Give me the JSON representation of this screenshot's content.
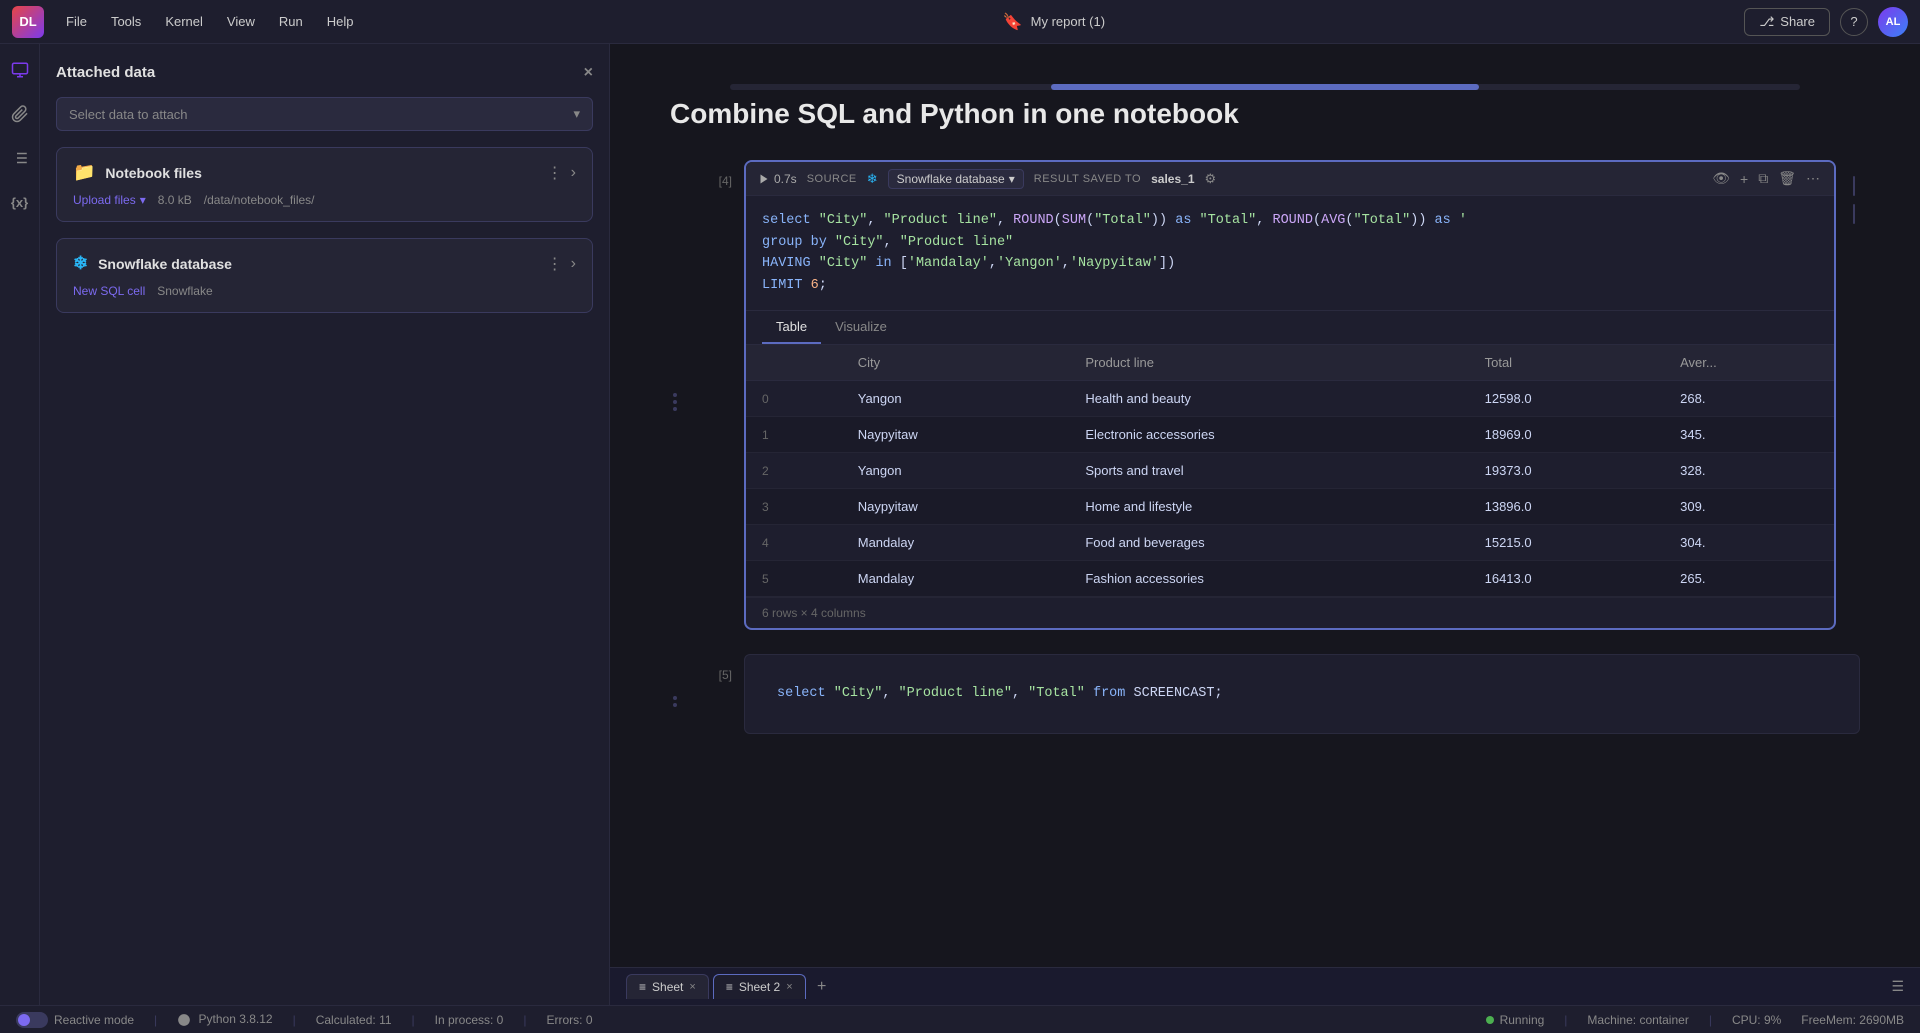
{
  "app": {
    "logo_text": "DL",
    "menu_items": [
      "File",
      "Tools",
      "Kernel",
      "View",
      "Run",
      "Help"
    ],
    "report_title": "My report (1)",
    "share_label": "Share",
    "help_label": "?",
    "avatar_text": "AL"
  },
  "left_panel": {
    "title": "Attached data",
    "close_label": "×",
    "select_placeholder": "Select data to attach",
    "cards": [
      {
        "id": "notebook_files",
        "title": "Notebook files",
        "upload_label": "Upload files",
        "size": "8.0 kB",
        "path": "/data/notebook_files/"
      },
      {
        "id": "snowflake_db",
        "title": "Snowflake database",
        "new_sql_label": "New SQL cell",
        "source": "Snowflake"
      }
    ]
  },
  "notebook": {
    "title": "Combine SQL and Python in one notebook",
    "cells": [
      {
        "number": "[4]",
        "run_time": "0.7s",
        "source": "Snowflake database",
        "result_saved_to": "sales_1",
        "code_lines": [
          "select \"City\", \"Product line\", ROUND(SUM(\"Total\")) as \"Total\", ROUND(AVG(\"Total\")) as '",
          "group by \"City\", \"Product line\"",
          "HAVING \"City\" in ['Mandalay','Yangon','Naypyitaw'])",
          "LIMIT 6;"
        ],
        "tabs": [
          "Table",
          "Visualize"
        ],
        "active_tab": "Table",
        "table": {
          "columns": [
            "",
            "City",
            "Product line",
            "Total",
            "Aver..."
          ],
          "rows": [
            [
              "0",
              "Yangon",
              "Health and beauty",
              "12598.0",
              "268."
            ],
            [
              "1",
              "Naypyitaw",
              "Electronic accessories",
              "18969.0",
              "345."
            ],
            [
              "2",
              "Yangon",
              "Sports and travel",
              "19373.0",
              "328."
            ],
            [
              "3",
              "Naypyitaw",
              "Home and lifestyle",
              "13896.0",
              "309."
            ],
            [
              "4",
              "Mandalay",
              "Food and beverages",
              "15215.0",
              "304."
            ],
            [
              "5",
              "Mandalay",
              "Fashion accessories",
              "16413.0",
              "265."
            ]
          ],
          "row_count": "6 rows × 4 columns"
        }
      },
      {
        "number": "[5]",
        "code": "select \"City\", \"Product line\", \"Total\" from SCREENCAST;"
      }
    ]
  },
  "bottom_tabs": {
    "sheets": [
      {
        "label": "Sheet",
        "active": false
      },
      {
        "label": "Sheet 2",
        "active": true
      }
    ],
    "add_label": "+"
  },
  "status_bar": {
    "reactive_mode_label": "Reactive mode",
    "python_version": "Python 3.8.12",
    "calculated": "Calculated: 11",
    "in_process": "In process: 0",
    "errors": "Errors: 0",
    "running_label": "Running",
    "machine_label": "Machine: container",
    "cpu_label": "CPU:  9%",
    "free_mem_label": "FreeMem: 2690MB"
  }
}
